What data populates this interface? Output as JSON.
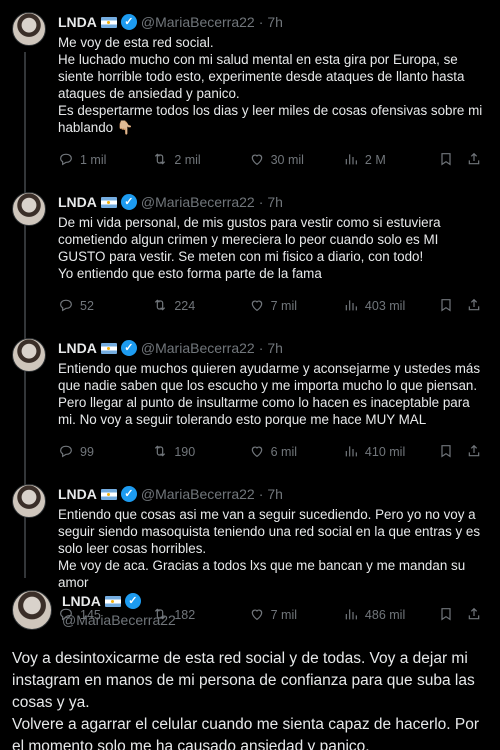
{
  "author": {
    "name": "LNDA",
    "handle": "@MariaBecerra22",
    "flag": "argentina-flag",
    "verified_icon": "verified-badge-icon"
  },
  "tweets": [
    {
      "time": "7h",
      "lines": [
        "Me voy de esta red social.",
        "He luchado mucho con mi salud mental en esta gira por Europa, se siente horrible todo esto, experimente desde ataques de llanto hasta ataques de ansiedad y panico.",
        "Es despertarme todos los dias y leer miles de cosas ofensivas sobre mi hablando 👇🏼"
      ],
      "replies": "1 mil",
      "retweets": "2 mil",
      "likes": "30 mil",
      "views": "2 M"
    },
    {
      "time": "7h",
      "lines": [
        "De mi vida personal, de mis gustos para vestir como si estuviera cometiendo algun crimen y mereciera lo peor cuando solo es MI GUSTO para vestir. Se meten con mi fisico a diario, con todo!",
        "Yo entiendo que esto forma parte de la fama"
      ],
      "replies": "52",
      "retweets": "224",
      "likes": "7 mil",
      "views": "403 mil"
    },
    {
      "time": "7h",
      "lines": [
        "Entiendo que muchos quieren ayudarme y aconsejarme y ustedes más que nadie saben que los escucho y me importa mucho lo que piensan. Pero llegar al punto de insultarme como lo hacen es inaceptable para mi. No voy a seguir tolerando esto porque me hace MUY MAL"
      ],
      "replies": "99",
      "retweets": "190",
      "likes": "6 mil",
      "views": "410 mil"
    },
    {
      "time": "7h",
      "lines": [
        "Entiendo que cosas asi me van a seguir sucediendo. Pero yo no voy a seguir siendo masoquista teniendo una red social en la que entras y es solo leer cosas horribles.",
        "Me voy de aca. Gracias a todos lxs que me bancan y me mandan su amor"
      ],
      "replies": "145",
      "retweets": "182",
      "likes": "7 mil",
      "views": "486 mil"
    }
  ],
  "main_tweet": {
    "lines": [
      "Voy a desintoxicarme de esta red social y de todas. Voy a dejar mi instagram en manos de mi persona de confianza para que suba las cosas y ya.",
      "Volvere a agarrar el celular cuando me sienta capaz de hacerlo. Por el momento solo me ha causado ansiedad y panico."
    ]
  },
  "colors": {
    "background": "#000000",
    "text": "#e7e9ea",
    "muted": "#71767b",
    "verified": "#1d9bf0",
    "thread_line": "#333639"
  }
}
